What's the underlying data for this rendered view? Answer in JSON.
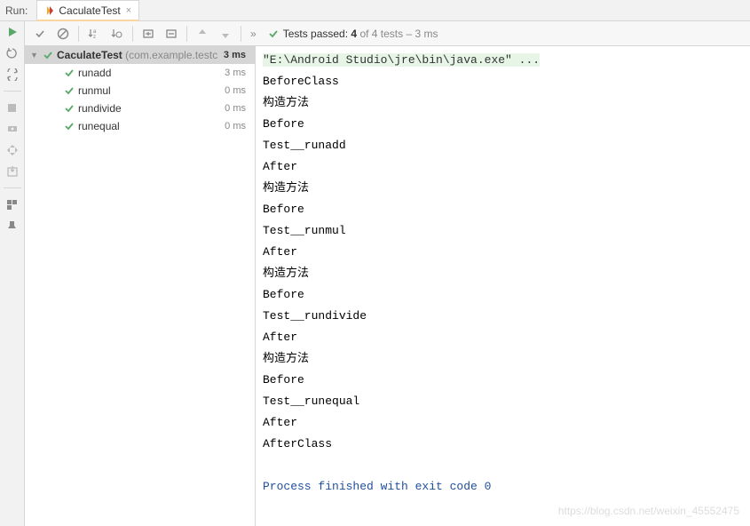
{
  "header": {
    "run_label": "Run:",
    "tab_name": "CaculateTest"
  },
  "toolbar": {
    "status": {
      "prefix": "Tests passed:",
      "passed": "4",
      "of_text": "of 4 tests",
      "dash_time": "– 3 ms"
    }
  },
  "tree": {
    "root": {
      "name": "CaculateTest",
      "package": "(com.example.testc",
      "time": "3 ms"
    },
    "items": [
      {
        "name": "runadd",
        "time": "3 ms"
      },
      {
        "name": "runmul",
        "time": "0 ms"
      },
      {
        "name": "rundivide",
        "time": "0 ms"
      },
      {
        "name": "runequal",
        "time": "0 ms"
      }
    ]
  },
  "console": {
    "cmd": "\"E:\\Android Studio\\jre\\bin\\java.exe\" ...",
    "lines": [
      "BeforeClass",
      "构造方法",
      "Before",
      "Test__runadd",
      "After",
      "构造方法",
      "Before",
      "Test__runmul",
      "After",
      "构造方法",
      "Before",
      "Test__rundivide",
      "After",
      "构造方法",
      "Before",
      "Test__runequal",
      "After",
      "AfterClass"
    ],
    "exit": "Process finished with exit code 0"
  },
  "watermark": "https://blog.csdn.net/weixin_45552475"
}
